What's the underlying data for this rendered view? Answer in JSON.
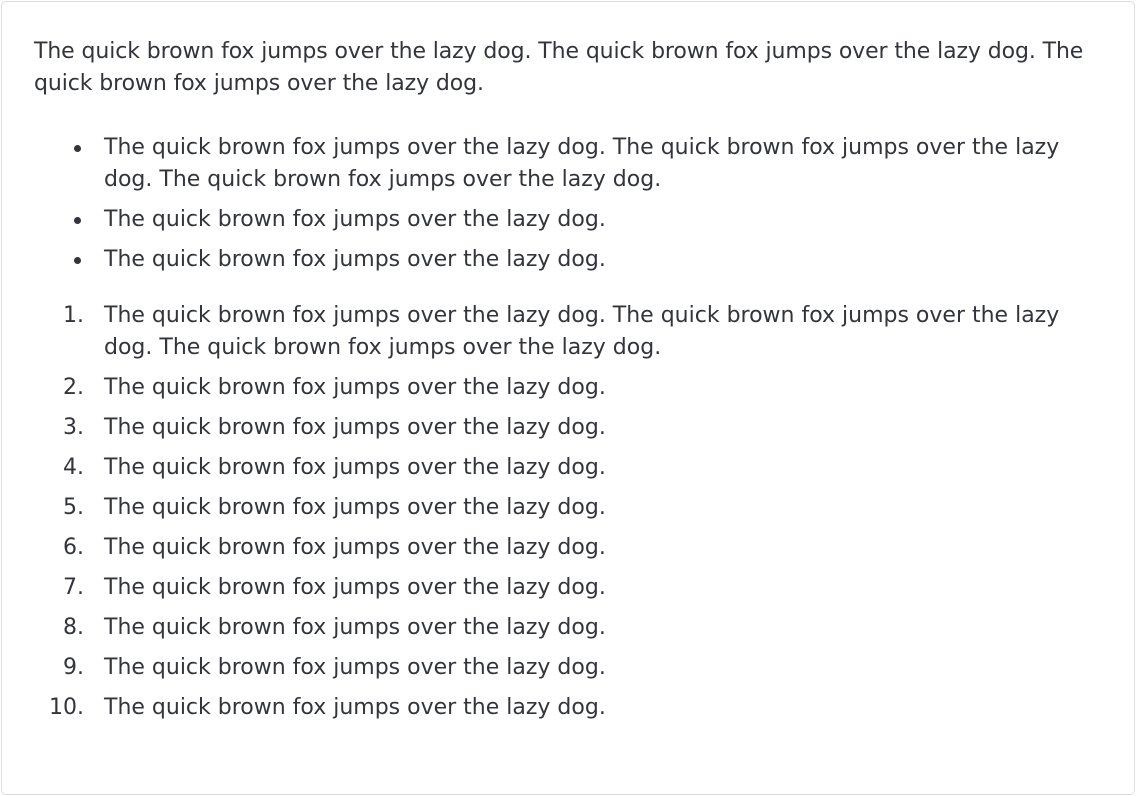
{
  "document": {
    "intro": "The quick brown fox jumps over the lazy dog. The quick brown fox jumps over the lazy dog. The quick brown fox jumps over the lazy dog.",
    "bullets": [
      "The quick brown fox jumps over the lazy dog. The quick brown fox jumps over the lazy dog. The quick brown fox jumps over the lazy dog.",
      "The quick brown fox jumps over the lazy dog.",
      "The quick brown fox jumps over the lazy dog."
    ],
    "numbered": [
      {
        "num": "1.",
        "text": "The quick brown fox jumps over the lazy dog. The quick brown fox jumps over the lazy dog. The quick brown fox jumps over the lazy dog."
      },
      {
        "num": "2.",
        "text": "The quick brown fox jumps over the lazy dog."
      },
      {
        "num": "3.",
        "text": "The quick brown fox jumps over the lazy dog."
      },
      {
        "num": "4.",
        "text": "The quick brown fox jumps over the lazy dog."
      },
      {
        "num": "5.",
        "text": "The quick brown fox jumps over the lazy dog."
      },
      {
        "num": "6.",
        "text": "The quick brown fox jumps over the lazy dog."
      },
      {
        "num": "7.",
        "text": "The quick brown fox jumps over the lazy dog."
      },
      {
        "num": "8.",
        "text": "The quick brown fox jumps over the lazy dog."
      },
      {
        "num": "9.",
        "text": "The quick brown fox jumps over the lazy dog."
      },
      {
        "num": "10.",
        "text": "The quick brown fox jumps over the lazy dog."
      }
    ]
  }
}
